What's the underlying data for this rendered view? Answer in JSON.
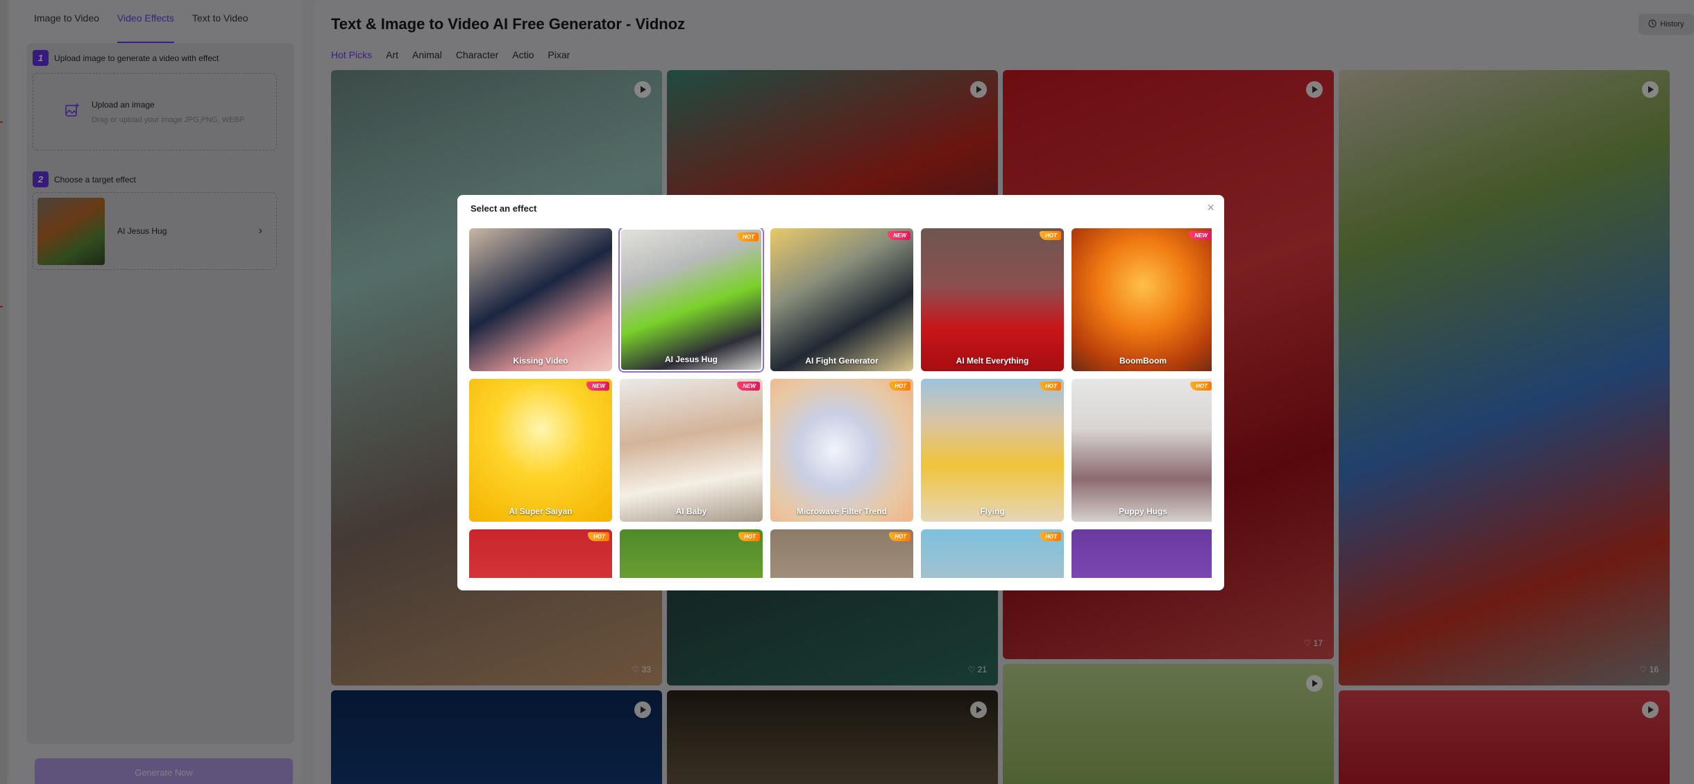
{
  "tabs": [
    "Image to Video",
    "Video Effects",
    "Text to Video"
  ],
  "active_tab": "Video Effects",
  "steps": {
    "step1": {
      "num": "1",
      "label": "Upload image to generate a video with effect"
    },
    "upload": {
      "title": "Upload an image",
      "sub": "Drag or upload your image JPG,PNG, WEBP"
    },
    "step2": {
      "num": "2",
      "label": "Choose a target effect"
    },
    "selected_effect": "AI Jesus Hug"
  },
  "generate_label": "Generate Now",
  "page_title": "Text & Image to Video AI Free Generator - Vidnoz",
  "history_label": "History",
  "categories": [
    "Hot Picks",
    "Art",
    "Animal",
    "Character",
    "Actio",
    "Pixar"
  ],
  "video_cards": [
    {
      "likes": "33"
    },
    {
      "likes": "21"
    },
    {
      "likes": "17"
    },
    {
      "likes": "16"
    }
  ],
  "modal": {
    "title": "Select an effect",
    "close": "×",
    "effects": [
      {
        "label": "Kissing Video",
        "badge": ""
      },
      {
        "label": "AI Jesus Hug",
        "badge": "HOT"
      },
      {
        "label": "AI Fight Generator",
        "badge": "NEW"
      },
      {
        "label": "AI Melt Everything",
        "badge": "HOT"
      },
      {
        "label": "BoomBoom",
        "badge": "NEW"
      },
      {
        "label": "AI Super Saiyan",
        "badge": "NEW"
      },
      {
        "label": "AI Baby",
        "badge": "NEW"
      },
      {
        "label": "Microwave Filter Trend",
        "badge": "HOT"
      },
      {
        "label": "Flying",
        "badge": "HOT"
      },
      {
        "label": "Puppy Hugs",
        "badge": "HOT"
      },
      {
        "label": "",
        "badge": "HOT"
      },
      {
        "label": "",
        "badge": "HOT"
      },
      {
        "label": "",
        "badge": "HOT"
      },
      {
        "label": "",
        "badge": "HOT"
      },
      {
        "label": "",
        "badge": ""
      }
    ]
  },
  "colors": {
    "accent": "#6b3cf0",
    "hot_badge": "#ff8c00",
    "new_badge": "#e0185c"
  }
}
